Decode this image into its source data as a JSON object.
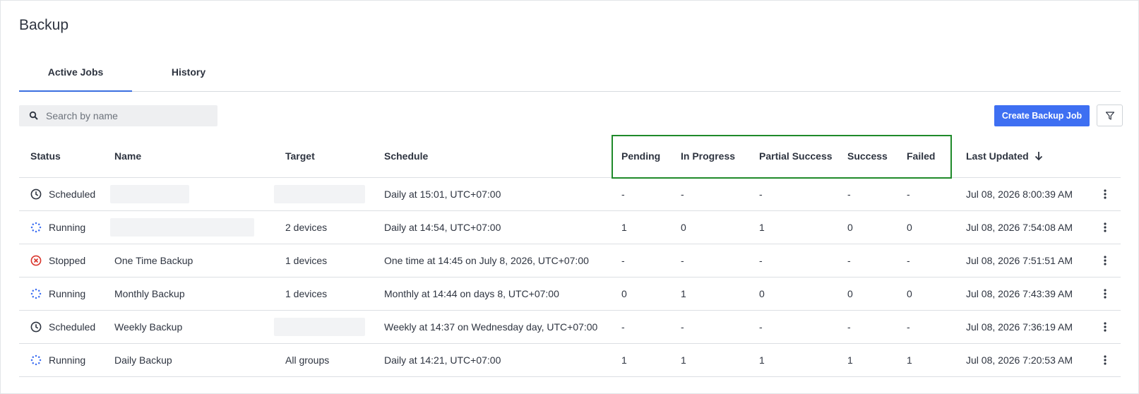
{
  "page": {
    "title": "Backup"
  },
  "tabs": [
    {
      "label": "Active Jobs",
      "active": true
    },
    {
      "label": "History",
      "active": false
    }
  ],
  "toolbar": {
    "search_placeholder": "Search by name",
    "create_label": "Create Backup Job",
    "search_icon": "search-icon",
    "filter_icon": "filter-icon"
  },
  "colors": {
    "accent": "#3e6ff2",
    "highlight": "#1f8a2a",
    "stopped": "#d9342b",
    "running": "#3e6ff2"
  },
  "table": {
    "columns": {
      "status": "Status",
      "name": "Name",
      "target": "Target",
      "schedule": "Schedule",
      "pending": "Pending",
      "in_progress": "In Progress",
      "partial_success": "Partial Success",
      "success": "Success",
      "failed": "Failed",
      "last_updated": "Last Updated"
    },
    "sort_icon": "arrow-down-icon",
    "rows": [
      {
        "status": "Scheduled",
        "status_icon": "clock-icon",
        "name": "",
        "target": "",
        "schedule": "Daily at 15:01, UTC+07:00",
        "pending": "-",
        "in_progress": "-",
        "partial_success": "-",
        "success": "-",
        "failed": "-",
        "last_updated": "Jul 08, 2026 8:00:39 AM"
      },
      {
        "status": "Running",
        "status_icon": "spinner-icon",
        "name": "",
        "target": "2 devices",
        "schedule": "Daily at 14:54, UTC+07:00",
        "pending": "1",
        "in_progress": "0",
        "partial_success": "1",
        "success": "0",
        "failed": "0",
        "last_updated": "Jul 08, 2026 7:54:08 AM"
      },
      {
        "status": "Stopped",
        "status_icon": "stopped-icon",
        "name": "One Time Backup",
        "target": "1 devices",
        "schedule": "One time at 14:45 on July 8, 2026, UTC+07:00",
        "pending": "-",
        "in_progress": "-",
        "partial_success": "-",
        "success": "-",
        "failed": "-",
        "last_updated": "Jul 08, 2026 7:51:51 AM"
      },
      {
        "status": "Running",
        "status_icon": "spinner-icon",
        "name": "Monthly Backup",
        "target": "1 devices",
        "schedule": "Monthly at 14:44 on days 8, UTC+07:00",
        "pending": "0",
        "in_progress": "1",
        "partial_success": "0",
        "success": "0",
        "failed": "0",
        "last_updated": "Jul 08, 2026 7:43:39 AM"
      },
      {
        "status": "Scheduled",
        "status_icon": "clock-icon",
        "name": "Weekly Backup",
        "target": "",
        "schedule": "Weekly at 14:37 on Wednesday day, UTC+07:00",
        "pending": "-",
        "in_progress": "-",
        "partial_success": "-",
        "success": "-",
        "failed": "-",
        "last_updated": "Jul 08, 2026 7:36:19 AM"
      },
      {
        "status": "Running",
        "status_icon": "spinner-icon",
        "name": "Daily Backup",
        "target": "All groups",
        "schedule": "Daily at 14:21, UTC+07:00",
        "pending": "1",
        "in_progress": "1",
        "partial_success": "1",
        "success": "1",
        "failed": "1",
        "last_updated": "Jul 08, 2026 7:20:53 AM"
      }
    ]
  }
}
